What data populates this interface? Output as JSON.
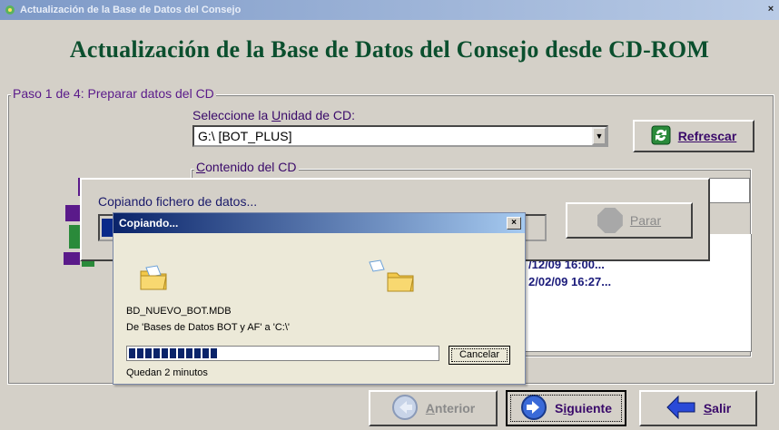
{
  "window": {
    "title": "Actualización de la Base de Datos del Consejo",
    "close": "×"
  },
  "header": {
    "title": "Actualización de la Base de Datos del Consejo desde CD-ROM"
  },
  "step": {
    "group_label": "Paso 1 de 4: Preparar datos del CD",
    "drive_label_pre": "Seleccione la ",
    "drive_label_u": "U",
    "drive_label_post": "nidad de CD:",
    "drive_value": "G:\\ [BOT_PLUS]",
    "refresh_label": "Refrescar",
    "content_label_pre": "C",
    "content_label_post": "ontenido del CD",
    "partial_line_1": "/12/09 16:00...",
    "partial_line_2": "2/02/09 16:27..."
  },
  "copy_dialog": {
    "message": "Copiando fichero de datos...",
    "stop_label": "Parar",
    "progress_fraction": 0.02
  },
  "xp_copy": {
    "title": "Copiando...",
    "close": "×",
    "file": "BD_NUEVO_BOT.MDB",
    "from": "De 'Bases de Datos BOT y AF' a 'C:\\'",
    "cancel": "Cancelar",
    "remaining": "Quedan 2 minutos",
    "progress_blocks": 11
  },
  "nav": {
    "back_label_u": "A",
    "back_label_rest": "nterior",
    "next_label_pre": "S",
    "next_label_u": "i",
    "next_label_rest": "guiente",
    "exit_label_u": "S",
    "exit_label_rest": "alir"
  },
  "colors": {
    "title_green": "#0b4f2e",
    "label_purple": "#3a0a6a",
    "xp_title_blue": "#0a246a"
  }
}
